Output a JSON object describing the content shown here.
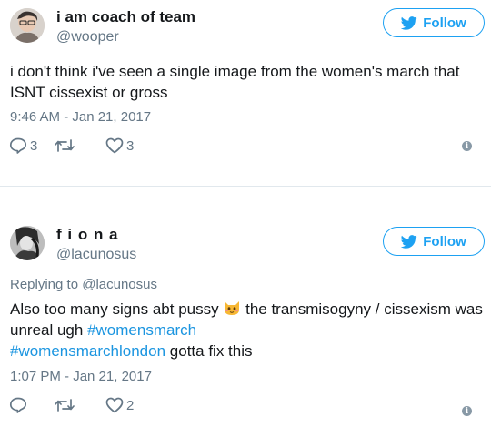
{
  "tweets": [
    {
      "name": "i am coach of team",
      "handle": "@wooper",
      "follow_label": "Follow",
      "text": "i don't think i've seen a single image from the women's march that ISNT cissexist or gross",
      "timestamp": "9:46 AM - Jan 21, 2017",
      "replies": "3",
      "retweets": "",
      "likes": "3"
    },
    {
      "name": "f i o n a",
      "handle": "@lacunosus",
      "follow_label": "Follow",
      "replying_prefix": "Replying to",
      "replying_handle": "@lacunosus",
      "text_part1": "Also too many signs abt pussy",
      "emoji": "cat-face-emoji",
      "text_part2": "the transmisogyny / cissexism was unreal ugh",
      "hashtag1": "#womensmarch",
      "hashtag2": "#womensmarchlondon",
      "text_part3": "gotta fix this",
      "timestamp": "1:07 PM - Jan 21, 2017",
      "replies": "",
      "retweets": "",
      "likes": "2"
    }
  ],
  "colors": {
    "accent": "#1da1f2",
    "hashtag": "#1b95e0",
    "muted": "#657786",
    "divider": "#e1e8ed"
  }
}
